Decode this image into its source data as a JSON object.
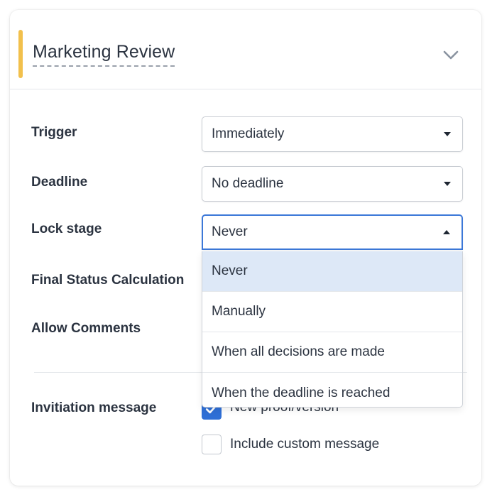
{
  "stage": {
    "title": "Marketing Review",
    "accent_color": "#f2c04c"
  },
  "fields": {
    "trigger": {
      "label": "Trigger",
      "value": "Immediately"
    },
    "deadline": {
      "label": "Deadline",
      "value": "No deadline"
    },
    "lock_stage": {
      "label": "Lock stage",
      "value": "Never",
      "options": [
        "Never",
        "Manually",
        "When all decisions are made",
        "When the deadline is reached"
      ]
    },
    "final_status": {
      "label": "Final Status Calculation"
    },
    "allow_comments": {
      "label": "Allow Comments"
    }
  },
  "invitation": {
    "label": "Invitiation message",
    "options": [
      {
        "label": "New proof/version",
        "checked": true
      },
      {
        "label": "Include custom message",
        "checked": false
      }
    ]
  },
  "icons": {
    "collapse": "chevron-down-icon",
    "dropdown_caret": "caret-down-icon",
    "dropdown_caret_open": "caret-up-icon"
  },
  "colors": {
    "selection_highlight": "#dde8f7",
    "focus_border": "#3c78d8",
    "checkbox_checked": "#2f6fd6"
  }
}
